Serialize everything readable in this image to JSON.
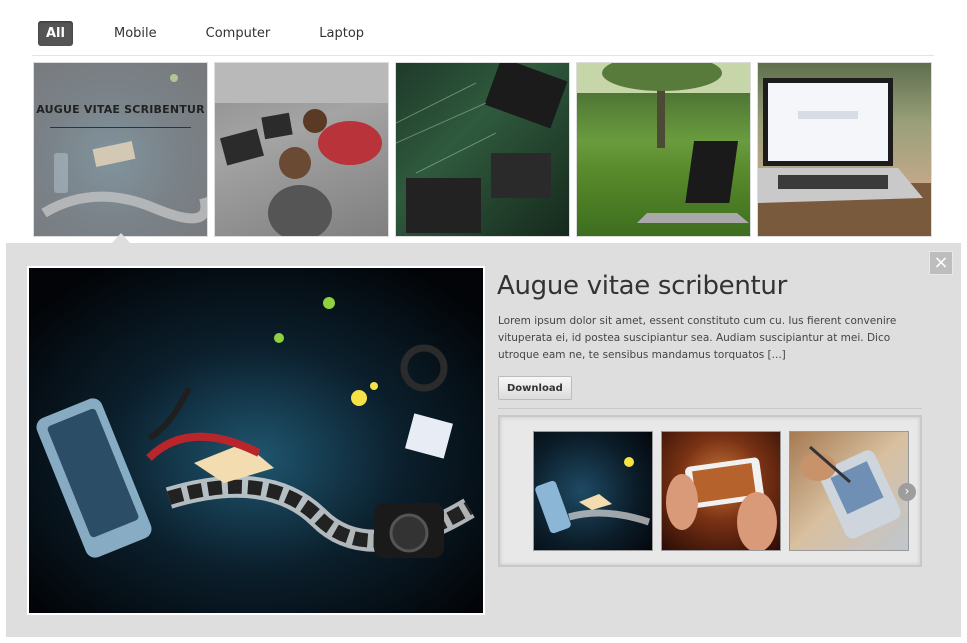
{
  "filters": [
    {
      "label": "All",
      "active": true
    },
    {
      "label": "Mobile",
      "active": false
    },
    {
      "label": "Computer",
      "active": false
    },
    {
      "label": "Laptop",
      "active": false
    }
  ],
  "grid": {
    "active_item_title": "AUGUE VITAE SCRIBENTUR",
    "items": [
      {
        "name": "multimedia-thumb"
      },
      {
        "name": "kids-laptop-thumb"
      },
      {
        "name": "circuit-board-thumb"
      },
      {
        "name": "laptop-grass-thumb"
      },
      {
        "name": "macbook-google-thumb"
      }
    ]
  },
  "detail": {
    "title": "Augue vitae scribentur",
    "description": "Lorem ipsum dolor sit amet, essent constituto cum cu. Ius fierent convenire vituperata ei, id postea suscipiantur sea. Audiam suscipiantur at mei. Dico utroque eam ne, te sensibus mandamus torquatos [...]",
    "download_label": "Download",
    "close_icon": "×",
    "next_icon": "›"
  },
  "colors": {
    "active_filter_bg": "#555555",
    "panel_bg": "#dedede"
  }
}
